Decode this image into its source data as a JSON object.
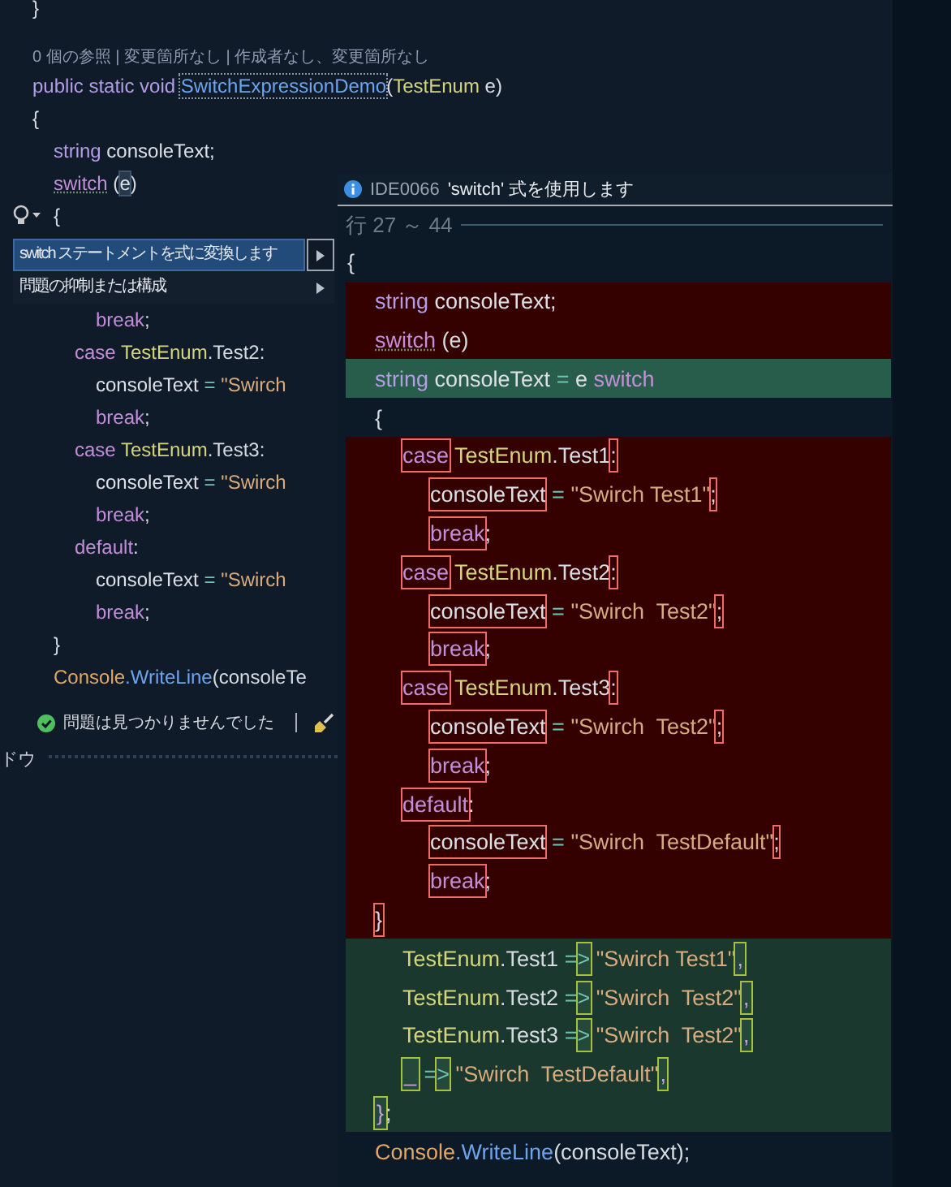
{
  "editor": {
    "lines": [
      {
        "kind": "code",
        "tokens": [
          {
            "kind": "punct",
            "text": "}"
          }
        ]
      },
      {
        "kind": "codelens",
        "text": "0 個の参照 | 変更箇所なし | 作成者なし、変更箇所なし"
      },
      {
        "kind": "code",
        "tokens": [
          {
            "kind": "type",
            "text": "public static void "
          },
          {
            "kind": "method",
            "text": "SwitchExpressionDemo",
            "dotted": true
          },
          {
            "kind": "punct",
            "text": "("
          },
          {
            "kind": "enum",
            "text": "TestEnum"
          },
          {
            "kind": "ident",
            "text": " e"
          },
          {
            "kind": "punct",
            "text": ")"
          }
        ]
      },
      {
        "kind": "code",
        "tokens": [
          {
            "kind": "punct",
            "text": "{"
          }
        ],
        "children": [
          {
            "kind": "code",
            "tokens": [
              {
                "kind": "type",
                "text": "string"
              },
              {
                "kind": "ident",
                "text": " consoleText;"
              }
            ]
          },
          {
            "kind": "code",
            "tokens": [
              {
                "kind": "keyword",
                "text": "switch",
                "squiggle": true
              },
              {
                "kind": "punct",
                "text": " ("
              },
              {
                "kind": "ident",
                "text": "e",
                "highlighted": true
              },
              {
                "kind": "punct",
                "text": ")"
              }
            ]
          },
          {
            "kind": "code",
            "lightbulb": true,
            "tokens": [
              {
                "kind": "punct",
                "text": "{"
              }
            ]
          }
        ]
      }
    ],
    "lines_after_menu": [
      {
        "children": [
          {
            "children": [
              {
                "children": [
                  {
                    "kind": "code",
                    "tokens": [
                      {
                        "kind": "keyword",
                        "text": "break"
                      },
                      {
                        "kind": "punct",
                        "text": ";"
                      }
                    ]
                  }
                ]
              },
              {
                "kind": "code",
                "tokens": [
                  {
                    "kind": "keyword",
                    "text": "case "
                  },
                  {
                    "kind": "enum",
                    "text": "TestEnum"
                  },
                  {
                    "kind": "punct",
                    "text": ".Test2:"
                  }
                ],
                "children": [
                  {
                    "kind": "code",
                    "tokens": [
                      {
                        "kind": "ident",
                        "text": "consoleText"
                      },
                      {
                        "kind": "operator",
                        "text": " = "
                      },
                      {
                        "kind": "string",
                        "text": "\"Swirch"
                      }
                    ]
                  },
                  {
                    "kind": "code",
                    "tokens": [
                      {
                        "kind": "keyword",
                        "text": "break"
                      },
                      {
                        "kind": "punct",
                        "text": ";"
                      }
                    ]
                  }
                ]
              },
              {
                "kind": "code",
                "tokens": [
                  {
                    "kind": "keyword",
                    "text": "case "
                  },
                  {
                    "kind": "enum",
                    "text": "TestEnum"
                  },
                  {
                    "kind": "punct",
                    "text": ".Test3:"
                  }
                ],
                "children": [
                  {
                    "kind": "code",
                    "tokens": [
                      {
                        "kind": "ident",
                        "text": "consoleText"
                      },
                      {
                        "kind": "operator",
                        "text": " = "
                      },
                      {
                        "kind": "string",
                        "text": "\"Swirch"
                      }
                    ]
                  },
                  {
                    "kind": "code",
                    "tokens": [
                      {
                        "kind": "keyword",
                        "text": "break"
                      },
                      {
                        "kind": "punct",
                        "text": ";"
                      }
                    ]
                  }
                ]
              },
              {
                "kind": "code",
                "tokens": [
                  {
                    "kind": "keyword",
                    "text": "default"
                  },
                  {
                    "kind": "punct",
                    "text": ":"
                  }
                ],
                "children": [
                  {
                    "kind": "code",
                    "tokens": [
                      {
                        "kind": "ident",
                        "text": "consoleText"
                      },
                      {
                        "kind": "operator",
                        "text": " = "
                      },
                      {
                        "kind": "string",
                        "text": "\"Swirch"
                      }
                    ]
                  },
                  {
                    "kind": "code",
                    "tokens": [
                      {
                        "kind": "keyword",
                        "text": "break"
                      },
                      {
                        "kind": "punct",
                        "text": ";"
                      }
                    ]
                  }
                ]
              }
            ]
          },
          {
            "kind": "code",
            "tokens": [
              {
                "kind": "punct",
                "text": "}"
              }
            ]
          },
          {
            "kind": "code",
            "tokens": [
              {
                "kind": "class",
                "text": "Console"
              },
              {
                "kind": "method",
                "text": ".WriteLine"
              },
              {
                "kind": "punct",
                "text": "(consoleTe"
              }
            ]
          }
        ]
      }
    ],
    "status": "問題は見つかりませんでした",
    "panel_tab": "ドウ"
  },
  "quick_actions": {
    "items": [
      {
        "text": "switch ステートメントを式に変換します",
        "selected": true
      },
      {
        "text": "問題の抑制または構成",
        "selected": false
      }
    ]
  },
  "preview": {
    "code": "IDE0066",
    "title": "'switch' 式を使用します",
    "range": "行 27 ～ 44",
    "lines": [
      {
        "kind": "plain",
        "tokens": [
          {
            "kind": "punct",
            "text": "{"
          }
        ],
        "children": [
          {
            "kind": "removed",
            "tokens": [
              {
                "kind": "type",
                "text": "string"
              },
              {
                "kind": "ident",
                "text": " consoleText;"
              }
            ]
          },
          {
            "kind": "removed",
            "tokens": [
              {
                "kind": "keyword",
                "text": "switch",
                "squiggle": true
              },
              {
                "kind": "punct",
                "text": " (e)"
              }
            ]
          },
          {
            "kind": "modified",
            "tokens": [
              {
                "kind": "type",
                "text": "string"
              },
              {
                "kind": "ident",
                "text": " consoleText "
              },
              {
                "kind": "operator",
                "text": "="
              },
              {
                "kind": "ident",
                "text": " e "
              },
              {
                "kind": "keyword",
                "text": "switch"
              }
            ]
          },
          {
            "kind": "plain",
            "tokens": [
              {
                "kind": "punct",
                "text": "{"
              }
            ],
            "children": [
              {
                "kind": "removed",
                "tokens": [
                  {
                    "kind": "keyword",
                    "text": "case",
                    "boxed": true
                  },
                  {
                    "kind": "enum",
                    "text": " TestEnum"
                  },
                  {
                    "kind": "punct",
                    "text": ".Test1"
                  },
                  {
                    "kind": "punct",
                    "text": ":",
                    "boxed": true
                  }
                ],
                "children": [
                  {
                    "kind": "removed",
                    "tokens": [
                      {
                        "kind": "ident",
                        "text": "consoleText",
                        "boxed": true
                      },
                      {
                        "kind": "operator",
                        "text": " = "
                      },
                      {
                        "kind": "string",
                        "text": "\"Swirch Test1\""
                      },
                      {
                        "kind": "punct",
                        "text": ";",
                        "boxed": true
                      }
                    ]
                  },
                  {
                    "kind": "removed",
                    "tokens": [
                      {
                        "kind": "keyword",
                        "text": "break",
                        "boxed": true
                      },
                      {
                        "kind": "punct",
                        "text": ";"
                      }
                    ]
                  }
                ]
              },
              {
                "kind": "removed",
                "tokens": [
                  {
                    "kind": "keyword",
                    "text": "case",
                    "boxed": true
                  },
                  {
                    "kind": "enum",
                    "text": " TestEnum"
                  },
                  {
                    "kind": "punct",
                    "text": ".Test2"
                  },
                  {
                    "kind": "punct",
                    "text": ":",
                    "boxed": true
                  }
                ],
                "children": [
                  {
                    "kind": "removed",
                    "tokens": [
                      {
                        "kind": "ident",
                        "text": "consoleText",
                        "boxed": true
                      },
                      {
                        "kind": "operator",
                        "text": " = "
                      },
                      {
                        "kind": "string",
                        "text": "\"Swirch  Test2\""
                      },
                      {
                        "kind": "punct",
                        "text": ";",
                        "boxed": true
                      }
                    ]
                  },
                  {
                    "kind": "removed",
                    "tokens": [
                      {
                        "kind": "keyword",
                        "text": "break",
                        "boxed": true
                      },
                      {
                        "kind": "punct",
                        "text": ";"
                      }
                    ]
                  }
                ]
              },
              {
                "kind": "removed",
                "tokens": [
                  {
                    "kind": "keyword",
                    "text": "case",
                    "boxed": true
                  },
                  {
                    "kind": "enum",
                    "text": " TestEnum"
                  },
                  {
                    "kind": "punct",
                    "text": ".Test3"
                  },
                  {
                    "kind": "punct",
                    "text": ":",
                    "boxed": true
                  }
                ],
                "children": [
                  {
                    "kind": "removed",
                    "tokens": [
                      {
                        "kind": "ident",
                        "text": "consoleText",
                        "boxed": true
                      },
                      {
                        "kind": "operator",
                        "text": " = "
                      },
                      {
                        "kind": "string",
                        "text": "\"Swirch  Test2\""
                      },
                      {
                        "kind": "punct",
                        "text": ";",
                        "boxed": true
                      }
                    ]
                  },
                  {
                    "kind": "removed",
                    "tokens": [
                      {
                        "kind": "keyword",
                        "text": "break",
                        "boxed": true
                      },
                      {
                        "kind": "punct",
                        "text": ";"
                      }
                    ]
                  }
                ]
              },
              {
                "kind": "removed",
                "tokens": [
                  {
                    "kind": "keyword",
                    "text": "default",
                    "boxed": true
                  },
                  {
                    "kind": "punct",
                    "text": ":"
                  }
                ],
                "children": [
                  {
                    "kind": "removed",
                    "tokens": [
                      {
                        "kind": "ident",
                        "text": "consoleText",
                        "boxed": true
                      },
                      {
                        "kind": "operator",
                        "text": " = "
                      },
                      {
                        "kind": "string",
                        "text": "\"Swirch  TestDefault\""
                      },
                      {
                        "kind": "punct",
                        "text": ";",
                        "boxed": true
                      }
                    ]
                  },
                  {
                    "kind": "removed",
                    "tokens": [
                      {
                        "kind": "keyword",
                        "text": "break",
                        "boxed": true
                      },
                      {
                        "kind": "punct",
                        "text": ";"
                      }
                    ]
                  }
                ]
              }
            ]
          },
          {
            "kind": "removed",
            "tokens": [
              {
                "kind": "punct",
                "text": "}",
                "boxed": true
              }
            ],
            "children": [
              {
                "kind": "added",
                "tokens": [
                  {
                    "kind": "enum",
                    "text": "TestEnum"
                  },
                  {
                    "kind": "punct",
                    "text": ".Test1 "
                  },
                  {
                    "kind": "operator",
                    "text": "="
                  },
                  {
                    "kind": "operator",
                    "text": ">",
                    "boxed": true
                  },
                  {
                    "kind": "string",
                    "text": " \"Swirch Test1\""
                  },
                  {
                    "kind": "punct",
                    "text": ",",
                    "boxed": true
                  }
                ]
              },
              {
                "kind": "added",
                "tokens": [
                  {
                    "kind": "enum",
                    "text": "TestEnum"
                  },
                  {
                    "kind": "punct",
                    "text": ".Test2 "
                  },
                  {
                    "kind": "operator",
                    "text": "="
                  },
                  {
                    "kind": "operator",
                    "text": ">",
                    "boxed": true
                  },
                  {
                    "kind": "string",
                    "text": " \"Swirch  Test2\""
                  },
                  {
                    "kind": "punct",
                    "text": ",",
                    "boxed": true
                  }
                ]
              },
              {
                "kind": "added",
                "tokens": [
                  {
                    "kind": "enum",
                    "text": "TestEnum"
                  },
                  {
                    "kind": "punct",
                    "text": ".Test3 "
                  },
                  {
                    "kind": "operator",
                    "text": "="
                  },
                  {
                    "kind": "operator",
                    "text": ">",
                    "boxed": true
                  },
                  {
                    "kind": "string",
                    "text": " \"Swirch  Test2\""
                  },
                  {
                    "kind": "punct",
                    "text": ",",
                    "boxed": true
                  }
                ]
              },
              {
                "kind": "added",
                "tokens": [
                  {
                    "kind": "punct",
                    "text": "_",
                    "boxed": true
                  },
                  {
                    "kind": "operator",
                    "text": " ="
                  },
                  {
                    "kind": "operator",
                    "text": ">",
                    "boxed": true
                  },
                  {
                    "kind": "string",
                    "text": " \"Swirch  TestDefault\""
                  },
                  {
                    "kind": "punct",
                    "text": ",",
                    "boxed": true
                  }
                ]
              }
            ]
          },
          {
            "kind": "added",
            "tokens": [
              {
                "kind": "punct",
                "text": "}",
                "boxed": true
              },
              {
                "kind": "punct",
                "text": ";"
              }
            ]
          },
          {
            "kind": "plain",
            "tokens": [
              {
                "kind": "class",
                "text": "Console"
              },
              {
                "kind": "method",
                "text": ".WriteLine"
              },
              {
                "kind": "punct",
                "text": "(consoleText);"
              }
            ]
          }
        ]
      }
    ]
  }
}
